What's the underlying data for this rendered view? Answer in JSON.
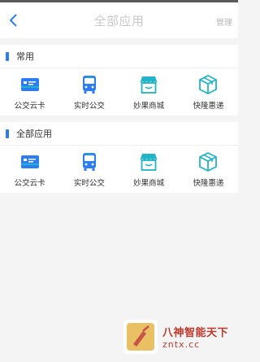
{
  "header": {
    "title": "全部应用",
    "manage_label": "管理"
  },
  "sections": [
    {
      "title": "常用",
      "apps": [
        {
          "label": "公交云卡",
          "icon": "bus-card-icon"
        },
        {
          "label": "实时公交",
          "icon": "bus-icon"
        },
        {
          "label": "妙果商城",
          "icon": "shop-icon"
        },
        {
          "label": "快隆惠递",
          "icon": "package-icon"
        }
      ]
    },
    {
      "title": "全部应用",
      "apps": [
        {
          "label": "公交云卡",
          "icon": "bus-card-icon"
        },
        {
          "label": "实时公交",
          "icon": "bus-icon"
        },
        {
          "label": "妙果商城",
          "icon": "shop-icon"
        },
        {
          "label": "快隆惠递",
          "icon": "package-icon"
        }
      ]
    }
  ],
  "watermark": {
    "line1": "八神智能天下",
    "line2": "zntx.cc"
  },
  "colors": {
    "accent": "#2c7cf2",
    "teal": "#21b3c9",
    "watermark": "#c0392b"
  }
}
